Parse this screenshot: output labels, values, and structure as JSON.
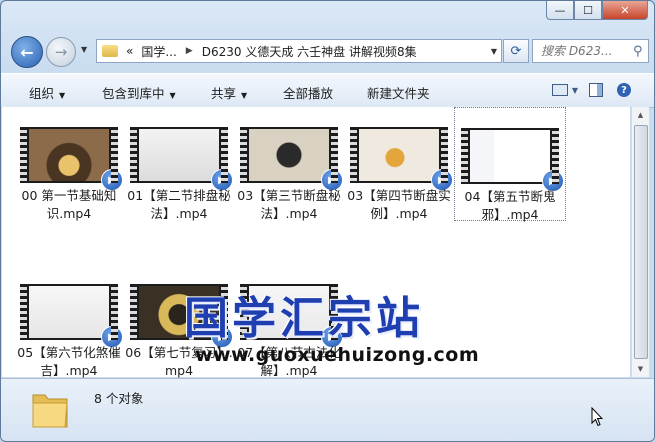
{
  "window": {
    "controls": {
      "minimize": "—",
      "maximize": "☐",
      "close": "✕"
    }
  },
  "nav": {
    "breadcrumb": [
      "国学...",
      "D6230 义德天成 六壬神盘 讲解视频8集"
    ],
    "crumb_prefix": "«",
    "search_placeholder": "搜索 D623..."
  },
  "toolbar": {
    "organize": "组织",
    "include_library": "包含到库中",
    "share": "共享",
    "play_all": "全部播放",
    "new_folder": "新建文件夹"
  },
  "files": [
    {
      "name": "00  第一节基础知识.mp4",
      "selected": false,
      "bg": "#8c6b4a"
    },
    {
      "name": "01【第二节排盘秘法】.mp4",
      "selected": false,
      "bg": "#ececec"
    },
    {
      "name": "03【第三节断盘秘法】.mp4",
      "selected": false,
      "bg": "#d9d2c3"
    },
    {
      "name": "03【第四节断盘实例】.mp4",
      "selected": false,
      "bg": "#efe9df"
    },
    {
      "name": "04【第五节断鬼邪】.mp4",
      "selected": true,
      "bg": "#f4f6fa"
    },
    {
      "name": "05【第六节化煞催吉】.mp4",
      "selected": false,
      "bg": "#f7f7f7"
    },
    {
      "name": "06【第七节复习】.mp4",
      "selected": false,
      "bg": "#3a3024"
    },
    {
      "name": "07【第八节古法化解】.mp4",
      "selected": false,
      "bg": "#f6f6f6"
    }
  ],
  "watermark": {
    "title": "国学汇宗站",
    "url": "www.guoxuehuizong.com"
  },
  "status": {
    "count": "8 个对象"
  }
}
